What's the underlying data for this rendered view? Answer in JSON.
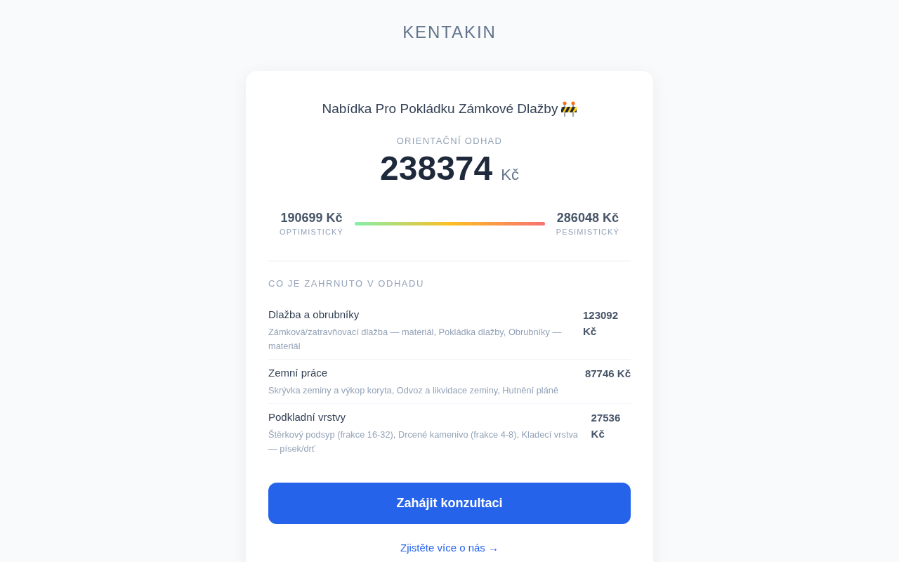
{
  "brand": "KENTAKIN",
  "quote": {
    "title": "Nabídka Pro Pokládku Zámkové Dlažby",
    "estimate_label": "ORIENTAČNÍ ODHAD",
    "estimate_value": "238374",
    "estimate_currency": "Kč",
    "range": {
      "low": {
        "value": "190699 Kč",
        "label": "OPTIMISTICKÝ"
      },
      "high": {
        "value": "286048 Kč",
        "label": "PESIMISTICKÝ"
      }
    }
  },
  "included": {
    "heading": "CO JE ZAHRNUTO V ODHADU",
    "items": [
      {
        "name": "Dlažba a obrubníky",
        "description": "Zámková/zatravňovací dlažba — materiál, Pokládka dlažby, Obrubníky — materiál",
        "price": "123092 Kč"
      },
      {
        "name": "Zemní práce",
        "description": "Skrývka zeminy a výkop koryta, Odvoz a likvidace zeminy, Hutnění pláně",
        "price": "87746 Kč"
      },
      {
        "name": "Podkladní vrstvy",
        "description": "Štěrkový podsyp (frakce 16-32), Drcené kamenivo (frakce 4-8), Kladecí vrstva — písek/drť",
        "price": "27536 Kč"
      }
    ]
  },
  "cta_button": "Zahájit konzultaci",
  "link": "Zjistěte více o nás →"
}
